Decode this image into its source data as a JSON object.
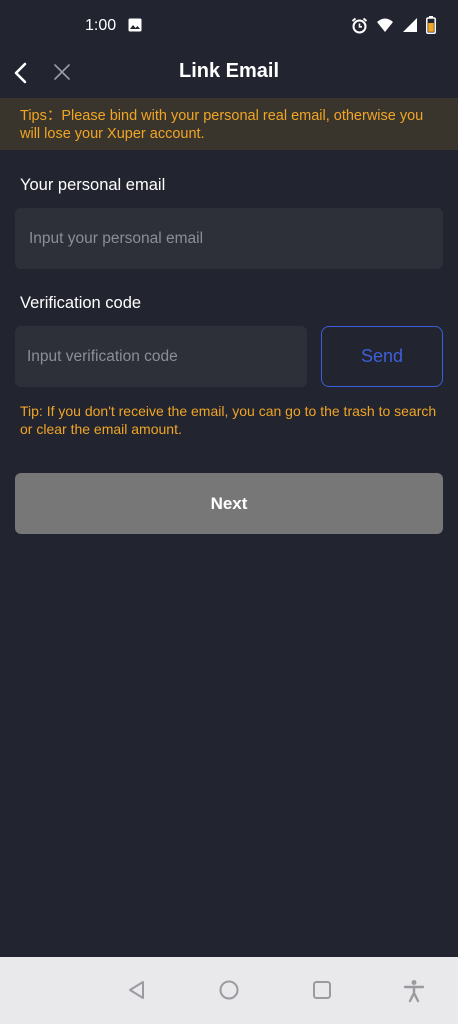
{
  "status_bar": {
    "time": "1:00"
  },
  "header": {
    "title": "Link Email"
  },
  "tips_banner": {
    "text": "Tips：Please bind with your personal real email, otherwise you will lose your Xuper account."
  },
  "email": {
    "label": "Your personal email",
    "placeholder": "Input your personal email",
    "value": ""
  },
  "verification": {
    "label": "Verification code",
    "placeholder": "Input verification code",
    "value": "",
    "send_label": "Send"
  },
  "tip": {
    "text": "Tip: If you don't receive the email, you can go to the trash to search or clear the email amount."
  },
  "next_label": "Next",
  "colors": {
    "background": "#222430",
    "tip_orange": "#f0a525",
    "send_blue": "#3c5fd8",
    "next_gray": "#777777"
  },
  "icons": {
    "status": [
      "image-icon",
      "alarm-icon",
      "wifi-icon",
      "signal-icon",
      "battery-icon"
    ],
    "header": [
      "back-arrow-icon",
      "close-icon"
    ],
    "nav": [
      "nav-back-icon",
      "nav-home-icon",
      "nav-recents-icon",
      "accessibility-icon"
    ]
  }
}
